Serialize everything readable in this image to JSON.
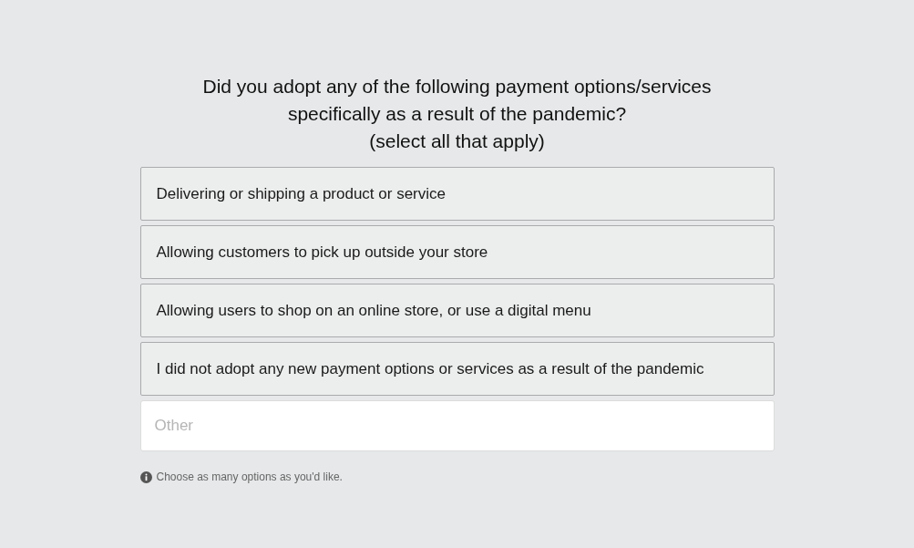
{
  "question": {
    "title_lines": [
      "Did you adopt any of the following payment options/services",
      "specifically as a result of the pandemic?",
      "(select all that apply)"
    ]
  },
  "options": [
    {
      "label": "Delivering or shipping a product or service",
      "selected": false
    },
    {
      "label": "Allowing customers to pick up outside your store",
      "selected": false
    },
    {
      "label": "Allowing users to shop on an online store, or use a digital menu",
      "selected": false
    },
    {
      "label": "I did not adopt any new payment options or services as a result of the pandemic",
      "selected": false
    }
  ],
  "other_field": {
    "placeholder": "Other"
  },
  "hint": "Choose as many options as you'd like."
}
